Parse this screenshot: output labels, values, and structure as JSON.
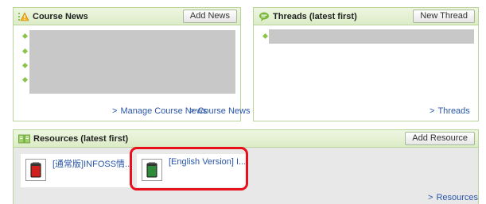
{
  "course_news": {
    "title": "Course News",
    "add_button": "Add News",
    "manage_link": "Manage Course News",
    "news_link": "Course News"
  },
  "threads": {
    "title": "Threads (latest first)",
    "new_button": "New Thread",
    "threads_link": "Threads"
  },
  "resources": {
    "title": "Resources (latest first)",
    "add_button": "Add Resource",
    "items": [
      {
        "label": "[通常版]INFOSS情...",
        "book_color": "#d0221c"
      },
      {
        "label": "[English Version] I...",
        "book_color": "#2f8b3a"
      }
    ],
    "resources_link": "Resources"
  },
  "colors": {
    "accent_green": "#8cc44a",
    "link_blue": "#2a56a8",
    "highlight_red": "#e8101a"
  }
}
